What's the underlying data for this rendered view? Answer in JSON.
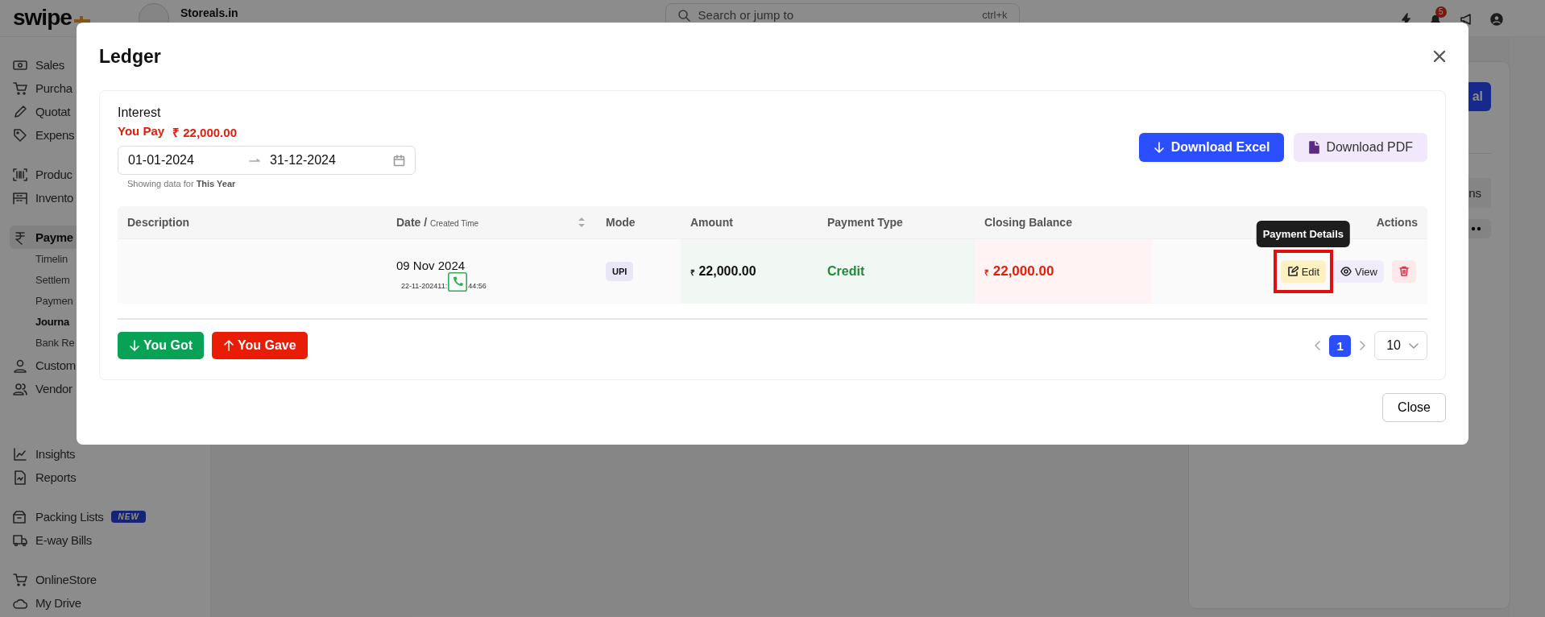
{
  "topbar": {
    "logo": "swipe",
    "business_name": "Storeals.in",
    "search": {
      "placeholder": "Search or jump to",
      "shortcut": "ctrl+k"
    },
    "notification_count": "5"
  },
  "sidebar": {
    "groups": [
      [
        {
          "label": "Sales",
          "selected": false
        },
        {
          "label": "Purcha",
          "selected": false
        },
        {
          "label": "Quotat",
          "selected": false
        },
        {
          "label": "Expens",
          "selected": false
        }
      ],
      [
        {
          "label": "Produc",
          "selected": false
        },
        {
          "label": "Invento",
          "selected": false
        }
      ],
      [
        {
          "label": "Payme",
          "selected": true,
          "children": [
            {
              "label": "Timelin",
              "selected": false
            },
            {
              "label": "Settlem",
              "selected": false
            },
            {
              "label": "Paymen",
              "selected": false
            },
            {
              "label": "Journa",
              "selected": true
            },
            {
              "label": "Bank Re",
              "selected": false
            }
          ]
        },
        {
          "label": "Custom",
          "selected": false
        },
        {
          "label": "Vendor",
          "selected": false
        }
      ],
      [
        {
          "label": "Insights",
          "selected": false
        },
        {
          "label": "Reports",
          "selected": false
        }
      ],
      [
        {
          "label": "Packing Lists",
          "selected": false,
          "badge": "NEW"
        },
        {
          "label": "E-way Bills",
          "selected": false
        }
      ],
      [
        {
          "label": "OnlineStore",
          "selected": false
        },
        {
          "label": "My Drive",
          "selected": false
        }
      ]
    ]
  },
  "page_behind": {
    "button_label": "al",
    "tab_label": "ns"
  },
  "modal": {
    "title": "Ledger",
    "party": "Interest",
    "balance_label": "You Pay",
    "balance_amount": "₹ 22,000.00",
    "date_range": {
      "from": "01-01-2024",
      "to": "31-12-2024"
    },
    "range_note": "Showing data for **This Year**",
    "actions": [
      {
        "kind": "excel",
        "label": "Download Excel"
      },
      {
        "kind": "pdf",
        "label": "Download PDF"
      }
    ],
    "table": {
      "columns": [
        {
          "label": "Description"
        },
        {
          "label": "Date / ",
          "sublabel": "Created Time",
          "sortable": true
        },
        {
          "label": "Mode"
        },
        {
          "label": "Amount"
        },
        {
          "label": "Payment Type"
        },
        {
          "label": "Closing Balance"
        },
        {
          "label": "Actions"
        }
      ],
      "rows": [
        {
          "date": "09 Nov 2024",
          "currency": "₹",
          "created_time": [
            "22-11-202411:",
            "44:56"
          ],
          "mode": "UPI",
          "amount": "22,000.00",
          "payment_type": "Credit",
          "closing_balance": "22,000.00",
          "row_actions": [
            {
              "kind": "edit",
              "label": "Edit",
              "highlighted": true,
              "tooltip": "Payment Details"
            },
            {
              "kind": "view",
              "label": "View",
              "highlighted": false
            },
            {
              "kind": "delete",
              "highlighted": false
            }
          ]
        }
      ]
    },
    "entry_buttons": [
      {
        "kind": "got",
        "label": "You Got"
      },
      {
        "kind": "gave",
        "label": "You Gave"
      }
    ],
    "pagination": {
      "pages": [
        {
          "label": "1",
          "selected": true
        }
      ],
      "page_size": "10"
    },
    "close_label": "Close"
  }
}
